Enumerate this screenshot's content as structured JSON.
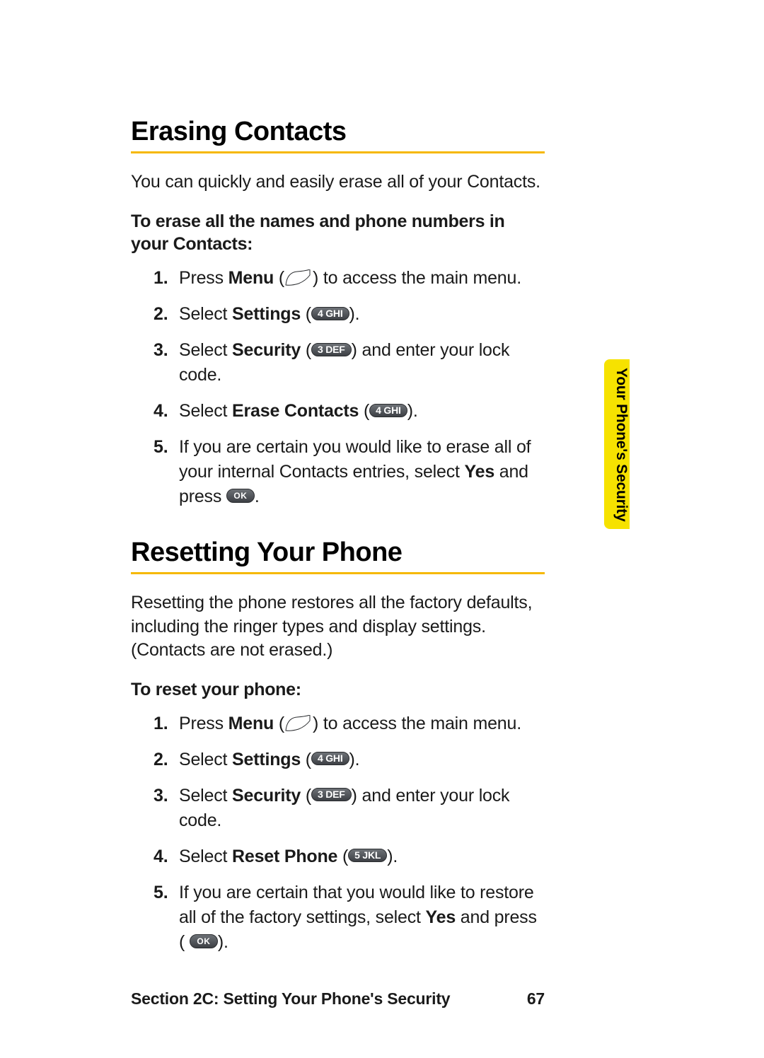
{
  "sideTab": "Your Phone's Security",
  "footer": {
    "left": "Section 2C: Setting Your Phone's Security",
    "page": "67"
  },
  "section1": {
    "title": "Erasing Contacts",
    "intro": "You can quickly and easily erase all of your Contacts.",
    "subhead": "To erase all the names and phone numbers in your Contacts:",
    "steps": {
      "s1_pre": "Press ",
      "s1_bold": "Menu",
      "s1_post": " to access the main menu.",
      "s2_pre": "Select ",
      "s2_bold": "Settings",
      "s3_pre": "Select ",
      "s3_bold": "Security",
      "s3_post": " and enter your lock code.",
      "s4_pre": "Select ",
      "s4_bold": "Erase Contacts",
      "s5_a": "If you are certain you would like to erase all of your internal Contacts entries, select ",
      "s5_yes": "Yes",
      "s5_b": " and press "
    }
  },
  "section2": {
    "title": "Resetting Your Phone",
    "intro": "Resetting the phone restores all the factory defaults, including the ringer types and display settings. (Contacts are not erased.)",
    "subhead": "To reset your phone:",
    "steps": {
      "s1_pre": "Press ",
      "s1_bold": "Menu",
      "s1_post": " to access the main menu.",
      "s2_pre": "Select ",
      "s2_bold": "Settings",
      "s3_pre": "Select ",
      "s3_bold": "Security",
      "s3_post": " and enter your lock code.",
      "s4_pre": "Select ",
      "s4_bold": "Reset Phone",
      "s5_a": "If you are certain that you would like to restore all of the factory settings, select ",
      "s5_yes": "Yes",
      "s5_b": " and press ("
    }
  },
  "keys": {
    "menu": "…",
    "k4": "4 GHI",
    "k3": "3 DEF",
    "k5": "5 JKL",
    "ok": "OK"
  },
  "nums": {
    "n1": "1.",
    "n2": "2.",
    "n3": "3.",
    "n4": "4.",
    "n5": "5."
  }
}
